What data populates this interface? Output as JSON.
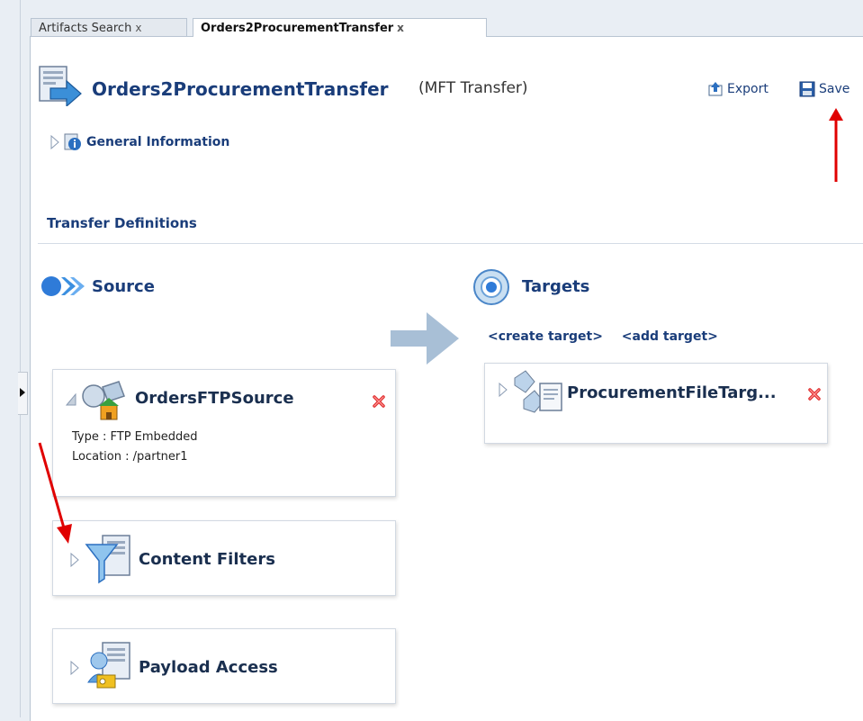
{
  "tabs": [
    {
      "label": "Artifacts Search",
      "close": "x"
    },
    {
      "label": "Orders2ProcurementTransfer",
      "close": "x"
    }
  ],
  "header": {
    "title": "Orders2ProcurementTransfer",
    "subtitle": "(MFT Transfer)",
    "export_label": "Export",
    "save_label": "Save"
  },
  "general_information": {
    "label": "General Information"
  },
  "transfer_definitions": {
    "label": "Transfer Definitions"
  },
  "source": {
    "heading": "Source",
    "card": {
      "name": "OrdersFTPSource",
      "type_line": "Type : FTP Embedded",
      "location_line": "Location : /partner1"
    },
    "content_filters": "Content Filters",
    "payload_access": "Payload Access"
  },
  "targets": {
    "heading": "Targets",
    "create_link": "<create target>",
    "add_link": "<add target>",
    "card": {
      "name": "ProcurementFileTarg..."
    }
  },
  "colors": {
    "title_blue": "#1a3d7a",
    "annotation_red": "#e00000",
    "flow_arrow": "#a8bfd6"
  }
}
